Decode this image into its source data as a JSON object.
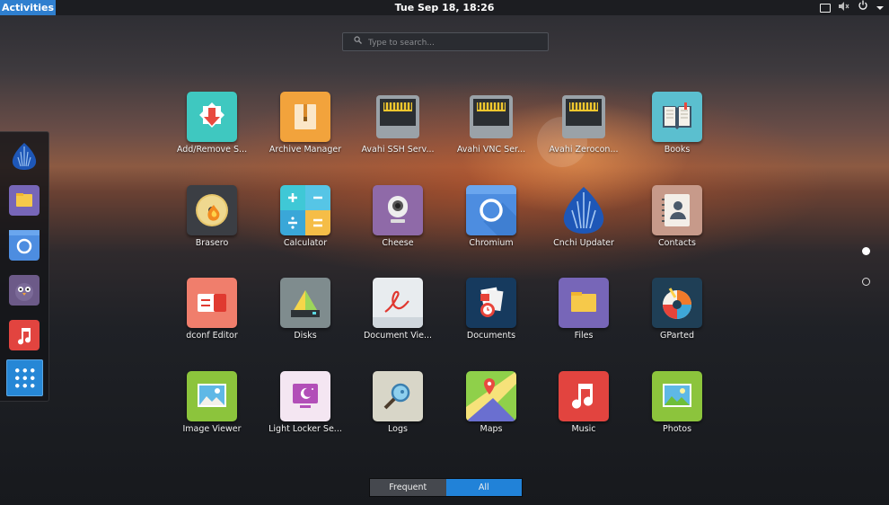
{
  "topbar": {
    "activities": "Activities",
    "clock": "Tue Sep 18, 18:26",
    "tray_icons": [
      "screen-icon",
      "volume-muted-icon",
      "power-icon",
      "chevron-down-icon"
    ]
  },
  "search": {
    "placeholder": "Type to search..."
  },
  "dash": {
    "items": [
      "Cnchi Updater",
      "Files",
      "Chromium",
      "Pidgin",
      "Music"
    ],
    "show_apps_icon": "grid-icon"
  },
  "apps": [
    {
      "label": "Add/Remove S...",
      "icon": "package-icon"
    },
    {
      "label": "Archive Manager",
      "icon": "archive-icon"
    },
    {
      "label": "Avahi SSH Serv...",
      "icon": "network-port-icon"
    },
    {
      "label": "Avahi VNC Ser...",
      "icon": "network-port-icon"
    },
    {
      "label": "Avahi Zerocon...",
      "icon": "network-port-icon"
    },
    {
      "label": "Books",
      "icon": "book-icon"
    },
    {
      "label": "Brasero",
      "icon": "disc-burner-icon"
    },
    {
      "label": "Calculator",
      "icon": "calculator-icon"
    },
    {
      "label": "Cheese",
      "icon": "webcam-icon"
    },
    {
      "label": "Chromium",
      "icon": "chromium-icon"
    },
    {
      "label": "Cnchi Updater",
      "icon": "antergos-icon"
    },
    {
      "label": "Contacts",
      "icon": "contacts-icon"
    },
    {
      "label": "dconf Editor",
      "icon": "dconf-icon"
    },
    {
      "label": "Disks",
      "icon": "disk-icon"
    },
    {
      "label": "Document Vie...",
      "icon": "document-viewer-icon"
    },
    {
      "label": "Documents",
      "icon": "documents-icon"
    },
    {
      "label": "Files",
      "icon": "folder-icon"
    },
    {
      "label": "GParted",
      "icon": "gparted-icon"
    },
    {
      "label": "Image Viewer",
      "icon": "image-icon"
    },
    {
      "label": "Light Locker Se...",
      "icon": "screen-lock-icon"
    },
    {
      "label": "Logs",
      "icon": "logs-icon"
    },
    {
      "label": "Maps",
      "icon": "map-icon"
    },
    {
      "label": "Music",
      "icon": "music-icon"
    },
    {
      "label": "Photos",
      "icon": "photo-icon"
    }
  ],
  "view_toggle": {
    "frequent": "Frequent",
    "all": "All",
    "selected": "All"
  },
  "colors": {
    "accent": "#2182d8",
    "topbar": "#1c1d21"
  }
}
